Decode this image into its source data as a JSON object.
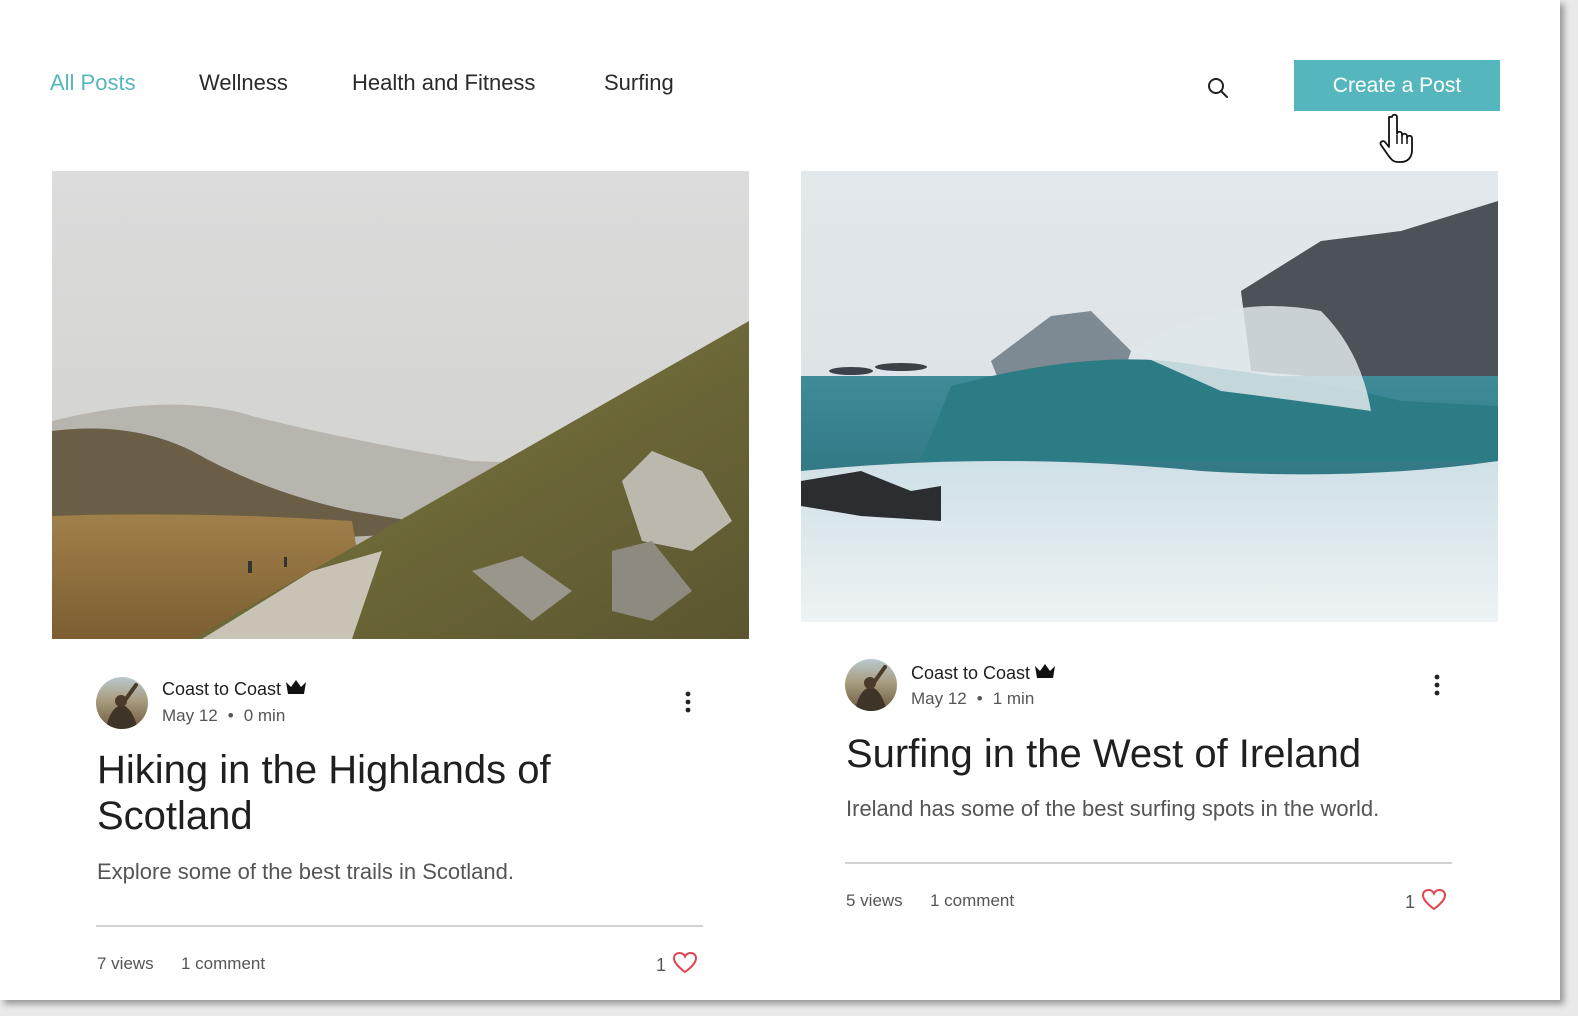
{
  "nav": {
    "items": [
      {
        "label": "All Posts",
        "active": true
      },
      {
        "label": "Wellness",
        "active": false
      },
      {
        "label": "Health and Fitness",
        "active": false
      },
      {
        "label": "Surfing",
        "active": false
      }
    ]
  },
  "header": {
    "search_icon": "search-icon",
    "create_label": "Create a Post"
  },
  "colors": {
    "accent": "#55b7bd",
    "heart": "#e0454f",
    "text": "#1f1f1f",
    "muted": "#555555"
  },
  "posts": [
    {
      "author": "Coast to Coast",
      "date": "May 12",
      "read_time": "0 min",
      "title_line1": "Hiking in the Highlands of",
      "title_line2": "Scotland",
      "excerpt": "Explore some of the best trails in Scotland.",
      "views": "7 views",
      "comments": "1 comment",
      "likes": "1"
    },
    {
      "author": "Coast to Coast",
      "date": "May 12",
      "read_time": "1 min",
      "title_line1": "Surfing in the West of Ireland",
      "excerpt": "Ireland has some of the best surfing spots in the world.",
      "views": "5 views",
      "comments": "1 comment",
      "likes": "1"
    }
  ]
}
